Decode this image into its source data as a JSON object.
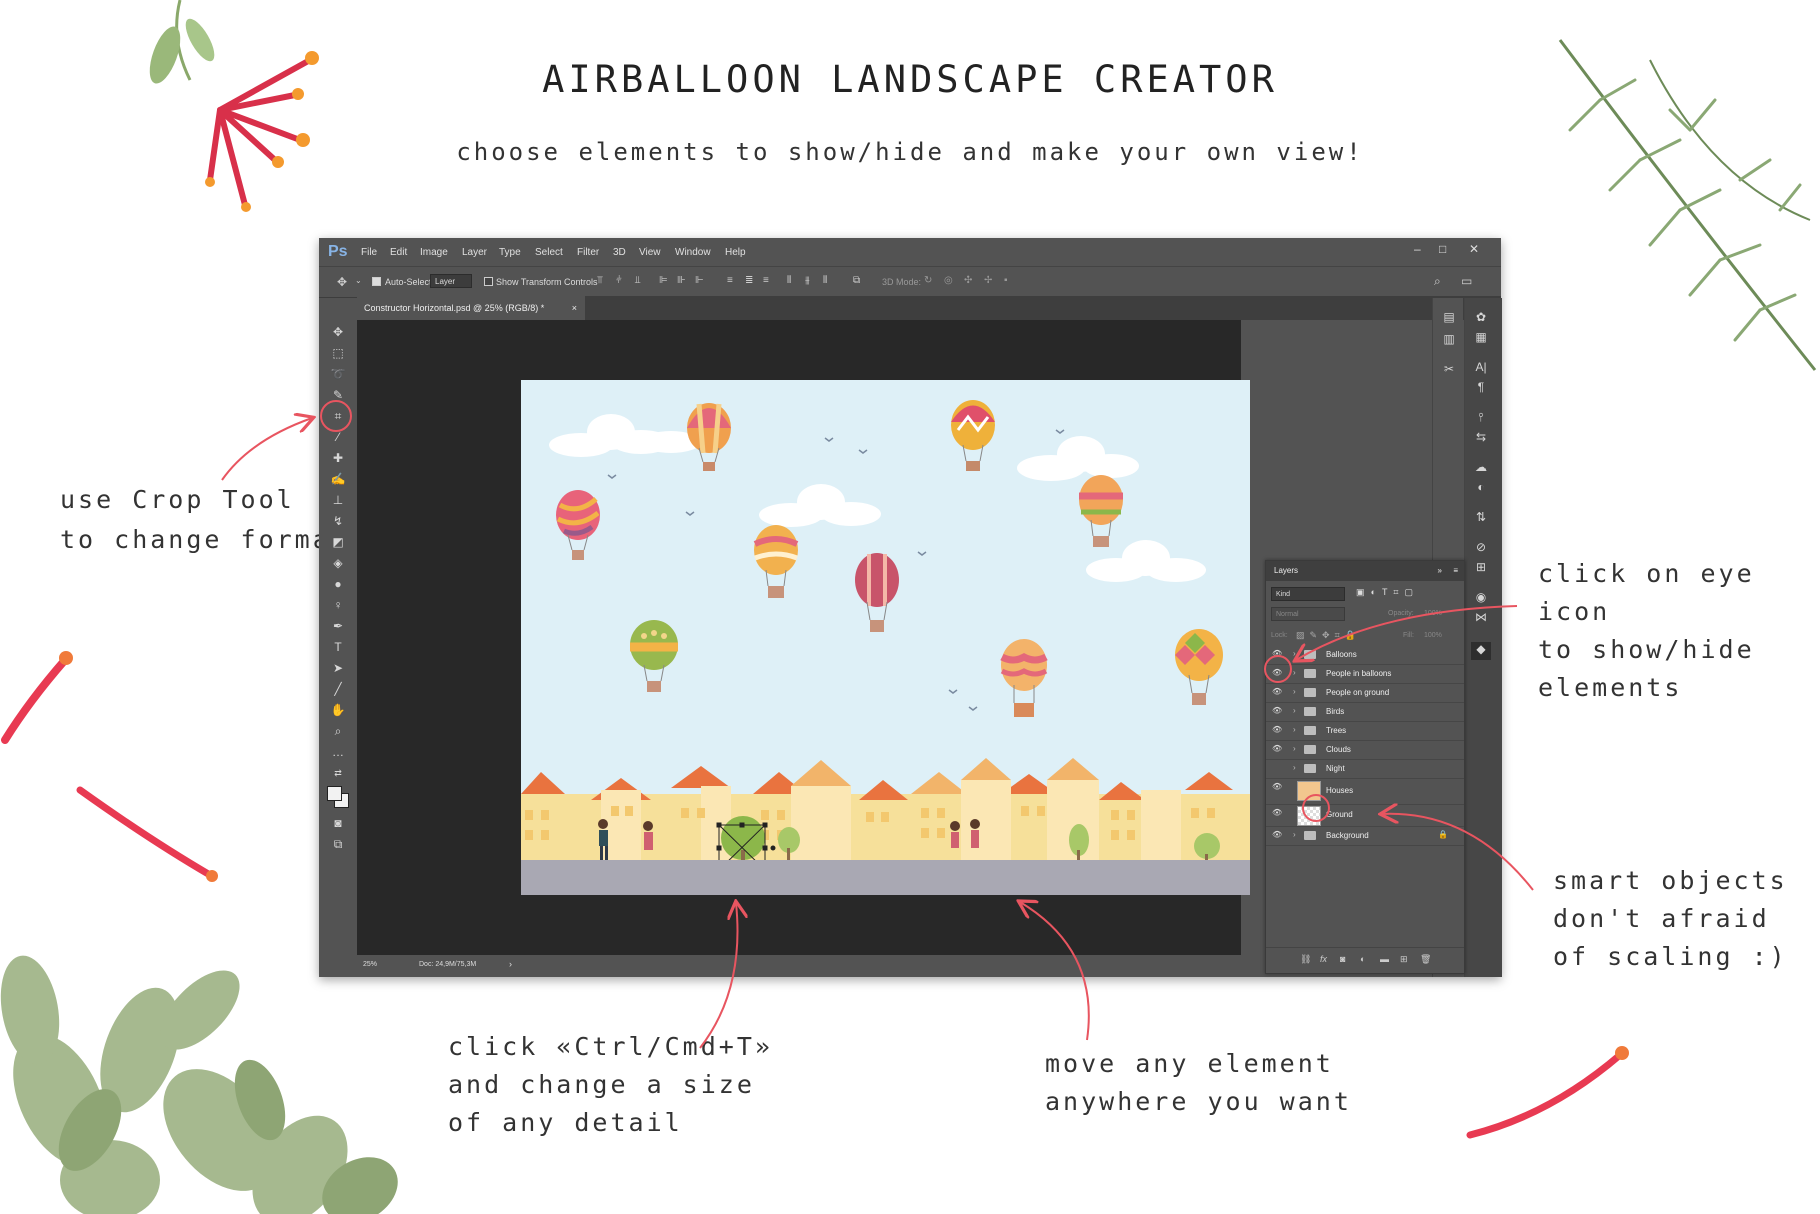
{
  "promo": {
    "title": "AIRBALLOON LANDSCAPE CREATOR",
    "subtitle": "choose elements to show/hide and make your own view!",
    "annotations": {
      "crop": "use Crop Tool\nto change format",
      "eye": "click on eye icon\nto show/hide\nelements",
      "smart": "smart objects\ndon't afraid\nof scaling :)",
      "ctrl": "click «Ctrl/Cmd+T»\nand change a size\nof any detail",
      "move": "move any element\nanywhere you want"
    }
  },
  "app": {
    "logo": "Ps",
    "menu": [
      "File",
      "Edit",
      "Image",
      "Layer",
      "Type",
      "Select",
      "Filter",
      "3D",
      "View",
      "Window",
      "Help"
    ],
    "options": {
      "auto_select_label": "Auto-Select:",
      "auto_select_value": "Layer",
      "transform_label": "Show Transform Controls",
      "mode_3d": "3D Mode:"
    },
    "doc_tab": "Constructor Horizontal.psd @ 25% (RGB/8) *",
    "status": {
      "zoom": "25%",
      "doc": "Doc: 24,9M/75,3M"
    }
  },
  "layers_panel": {
    "title": "Layers",
    "filter_kind": "Kind",
    "blend_mode": "Normal",
    "opacity_label": "Opacity:",
    "opacity_value": "100%",
    "lock_label": "Lock:",
    "fill_label": "Fill:",
    "fill_value": "100%",
    "layers": [
      {
        "name": "Balloons",
        "type": "group",
        "visible": true
      },
      {
        "name": "People in balloons",
        "type": "group",
        "visible": true
      },
      {
        "name": "People on ground",
        "type": "group",
        "visible": true
      },
      {
        "name": "Birds",
        "type": "group",
        "visible": true
      },
      {
        "name": "Trees",
        "type": "group",
        "visible": true
      },
      {
        "name": "Clouds",
        "type": "group",
        "visible": true
      },
      {
        "name": "Night",
        "type": "group",
        "visible": false
      },
      {
        "name": "Houses",
        "type": "smart-object",
        "visible": true
      },
      {
        "name": "Ground",
        "type": "layer",
        "visible": true
      },
      {
        "name": "Background",
        "type": "group",
        "visible": true,
        "locked": true
      }
    ]
  },
  "colors": {
    "annotation_red": "#e85560",
    "ps_panel": "#535353",
    "ps_canvas": "#282828",
    "sky": "#def0f7",
    "ground": "#a9a8b3"
  }
}
